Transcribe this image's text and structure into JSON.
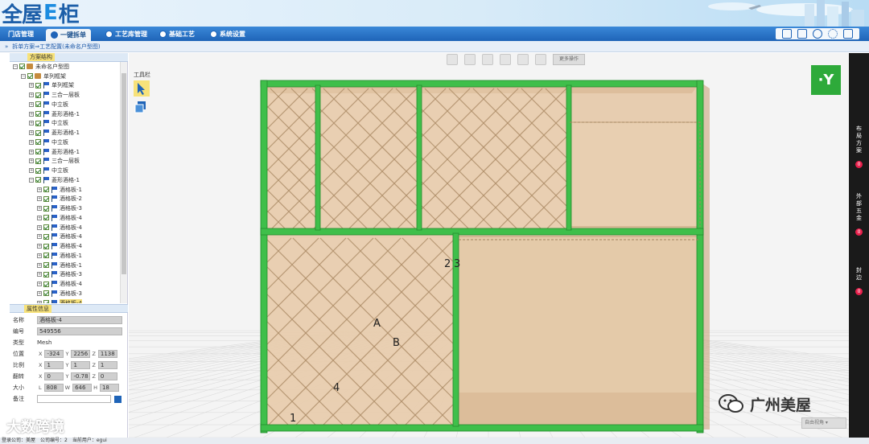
{
  "app": {
    "logo_left": "全屋",
    "logo_e": "E",
    "logo_right": "柜"
  },
  "nav": {
    "tabs": [
      {
        "label": "门店管理"
      },
      {
        "label": "一键拆单"
      },
      {
        "label": "工艺库管理"
      },
      {
        "label": "基础工艺"
      },
      {
        "label": "系统设置"
      }
    ],
    "active_index": 1,
    "icons": [
      "document-icon",
      "calendar-icon",
      "help-icon",
      "settings-icon",
      "exit-icon"
    ]
  },
  "breadcrumb": {
    "text": "拆单方案⇒工艺配置(未命名户型图)"
  },
  "tree": {
    "header": "方案结构",
    "nodes": [
      {
        "label": "未命名户型图",
        "depth": 0,
        "type": "root"
      },
      {
        "label": "单列框架",
        "depth": 1,
        "type": "box"
      },
      {
        "label": "单列框架",
        "depth": 2,
        "type": "flag"
      },
      {
        "label": "三合一层板",
        "depth": 2,
        "type": "flag"
      },
      {
        "label": "中立板",
        "depth": 2,
        "type": "flag"
      },
      {
        "label": "菱形酒格-1",
        "depth": 2,
        "type": "flag"
      },
      {
        "label": "中立板",
        "depth": 2,
        "type": "flag"
      },
      {
        "label": "菱形酒格-1",
        "depth": 2,
        "type": "flag"
      },
      {
        "label": "中立板",
        "depth": 2,
        "type": "flag"
      },
      {
        "label": "菱形酒格-1",
        "depth": 2,
        "type": "flag"
      },
      {
        "label": "三合一层板",
        "depth": 2,
        "type": "flag"
      },
      {
        "label": "中立板",
        "depth": 2,
        "type": "flag"
      },
      {
        "label": "菱形酒格-1",
        "depth": 2,
        "type": "flag"
      },
      {
        "label": "酒格板-1",
        "depth": 3,
        "type": "flag"
      },
      {
        "label": "酒格板-2",
        "depth": 3,
        "type": "flag"
      },
      {
        "label": "酒格板-3",
        "depth": 3,
        "type": "flag"
      },
      {
        "label": "酒格板-4",
        "depth": 3,
        "type": "flag"
      },
      {
        "label": "酒格板-4",
        "depth": 3,
        "type": "flag"
      },
      {
        "label": "酒格板-4",
        "depth": 3,
        "type": "flag"
      },
      {
        "label": "酒格板-4",
        "depth": 3,
        "type": "flag"
      },
      {
        "label": "酒格板-1",
        "depth": 3,
        "type": "flag"
      },
      {
        "label": "酒格板-1",
        "depth": 3,
        "type": "flag"
      },
      {
        "label": "酒格板-3",
        "depth": 3,
        "type": "flag"
      },
      {
        "label": "酒格板-4",
        "depth": 3,
        "type": "flag"
      },
      {
        "label": "酒格板-3",
        "depth": 3,
        "type": "flag"
      },
      {
        "label": "酒格板-4",
        "depth": 3,
        "type": "flag",
        "selected": true
      }
    ]
  },
  "properties": {
    "header": "属性信息",
    "name_label": "名称",
    "name_value": "酒格板-4",
    "code_label": "编号",
    "code_value": "549556",
    "type_label": "类型",
    "type_value": "Mesh",
    "position_label": "位置",
    "position": {
      "x": "-324",
      "y": "2256",
      "z": "1138"
    },
    "scale_label": "比例",
    "scale": {
      "x": "1",
      "y": "1",
      "z": "1"
    },
    "rotation_label": "翻转",
    "rotation": {
      "x": "0",
      "y": "-0.78",
      "z": "0"
    },
    "size_label": "大小",
    "size": {
      "l": "808",
      "w": "646",
      "h": "18"
    },
    "note_label": "备注",
    "note_value": ""
  },
  "toolbox": {
    "label": "工具栏"
  },
  "viewport": {
    "more_ops": "更多操作",
    "view_select": "自由视角",
    "y_button": "·Y",
    "labels": [
      "A",
      "B",
      "1",
      "2",
      "3",
      "4"
    ]
  },
  "right_panel": {
    "sections": [
      {
        "label": "布局方案",
        "count": "0"
      },
      {
        "label": "外部五金",
        "count": "0"
      },
      {
        "label": "封边",
        "count": "0"
      }
    ]
  },
  "watermarks": {
    "left": "大数跨境",
    "right": "广州美屋"
  },
  "status": {
    "text": "登录公司：美屋　公司编号：2　当前用户：egui"
  },
  "colors": {
    "nav_blue": "#1f64b8",
    "frame_green": "#3fbf4a",
    "panel_wood": "#e5c9a8",
    "accent_yellow": "#f7e27a"
  }
}
